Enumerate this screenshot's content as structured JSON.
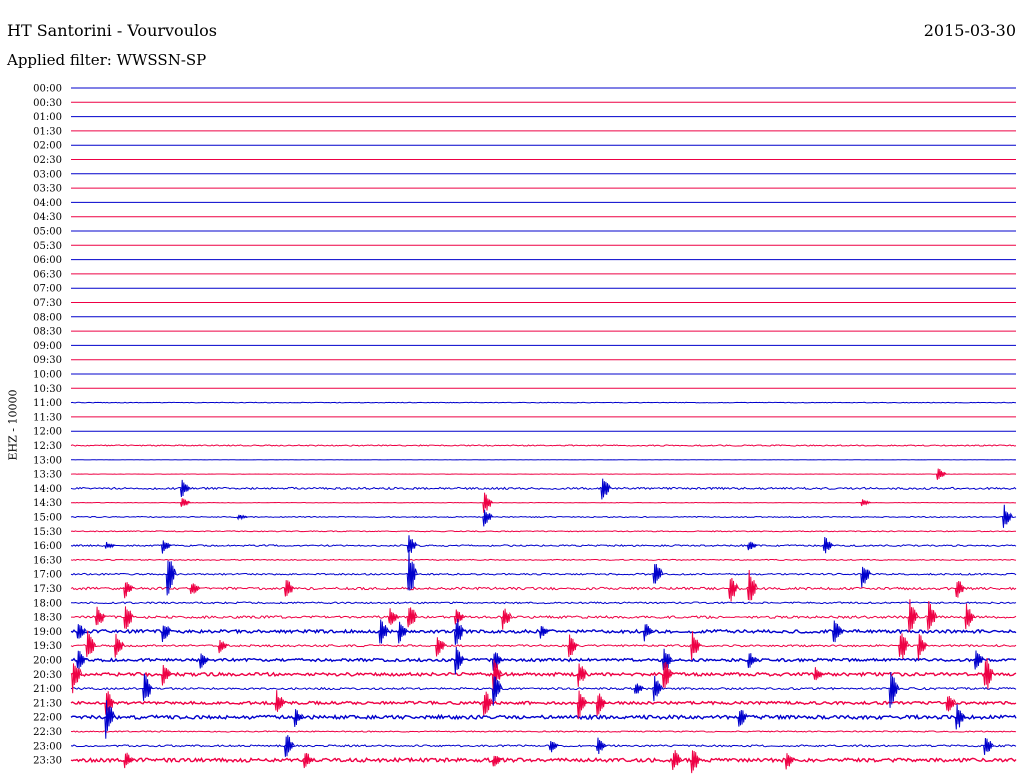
{
  "header": {
    "station": "HT Santorini - Vourvoulos",
    "date": "2015-03-30",
    "filter_label": "Applied filter: WWSSN-SP"
  },
  "chart_data": {
    "type": "line",
    "channel_label": "EHZ - 10000",
    "row_labels": [
      "00:00",
      "00:30",
      "01:00",
      "01:30",
      "02:00",
      "02:30",
      "03:00",
      "03:30",
      "04:00",
      "04:30",
      "05:00",
      "05:30",
      "06:00",
      "06:30",
      "07:00",
      "07:30",
      "08:00",
      "08:30",
      "09:00",
      "09:30",
      "10:00",
      "10:30",
      "11:00",
      "11:30",
      "12:00",
      "12:30",
      "13:00",
      "13:30",
      "14:00",
      "14:30",
      "15:00",
      "15:30",
      "16:00",
      "16:30",
      "17:00",
      "17:30",
      "18:00",
      "18:30",
      "19:00",
      "19:30",
      "20:00",
      "20:30",
      "21:00",
      "21:30",
      "22:00",
      "22:30",
      "23:00",
      "23:30"
    ],
    "trace_colors": [
      "#0000cc",
      "#ee0044"
    ],
    "noise_levels": [
      0,
      0,
      0,
      0,
      0,
      0,
      0,
      0,
      0,
      0,
      0,
      0,
      0,
      0,
      0,
      0,
      0,
      0,
      0,
      0,
      0,
      0,
      0.3,
      0,
      0,
      0.6,
      0.1,
      0.15,
      1.0,
      0.2,
      0.5,
      0.5,
      0.8,
      0.5,
      0.8,
      1.2,
      0.8,
      1.2,
      1.6,
      1.0,
      1.4,
      1.6,
      1.0,
      1.4,
      1.8,
      0.6,
      0.9,
      1.8
    ],
    "events": [
      {
        "row": 27,
        "x": 0.92,
        "amp": 8
      },
      {
        "row": 28,
        "x": 0.12,
        "amp": 10
      },
      {
        "row": 28,
        "x": 0.565,
        "amp": 14
      },
      {
        "row": 29,
        "x": 0.12,
        "amp": 6
      },
      {
        "row": 29,
        "x": 0.44,
        "amp": 12
      },
      {
        "row": 29,
        "x": 0.84,
        "amp": 4
      },
      {
        "row": 30,
        "x": 0.18,
        "amp": 3
      },
      {
        "row": 30,
        "x": 0.44,
        "amp": 10
      },
      {
        "row": 30,
        "x": 0.99,
        "amp": 14
      },
      {
        "row": 32,
        "x": 0.04,
        "amp": 4
      },
      {
        "row": 32,
        "x": 0.1,
        "amp": 8
      },
      {
        "row": 32,
        "x": 0.36,
        "amp": 12
      },
      {
        "row": 32,
        "x": 0.72,
        "amp": 6
      },
      {
        "row": 32,
        "x": 0.8,
        "amp": 10
      },
      {
        "row": 34,
        "x": 0.105,
        "amp": 25
      },
      {
        "row": 34,
        "x": 0.36,
        "amp": 30
      },
      {
        "row": 34,
        "x": 0.62,
        "amp": 18
      },
      {
        "row": 34,
        "x": 0.84,
        "amp": 14
      },
      {
        "row": 35,
        "x": 0.06,
        "amp": 10
      },
      {
        "row": 35,
        "x": 0.13,
        "amp": 8
      },
      {
        "row": 35,
        "x": 0.23,
        "amp": 12
      },
      {
        "row": 35,
        "x": 0.7,
        "amp": 16
      },
      {
        "row": 35,
        "x": 0.72,
        "amp": 22
      },
      {
        "row": 35,
        "x": 0.94,
        "amp": 12
      },
      {
        "row": 37,
        "x": 0.03,
        "amp": 14
      },
      {
        "row": 37,
        "x": 0.06,
        "amp": 16
      },
      {
        "row": 37,
        "x": 0.34,
        "amp": 12
      },
      {
        "row": 37,
        "x": 0.36,
        "amp": 18
      },
      {
        "row": 37,
        "x": 0.41,
        "amp": 10
      },
      {
        "row": 37,
        "x": 0.46,
        "amp": 14
      },
      {
        "row": 37,
        "x": 0.89,
        "amp": 20
      },
      {
        "row": 37,
        "x": 0.91,
        "amp": 18
      },
      {
        "row": 37,
        "x": 0.95,
        "amp": 16
      },
      {
        "row": 38,
        "x": 0.01,
        "amp": 10
      },
      {
        "row": 38,
        "x": 0.1,
        "amp": 12
      },
      {
        "row": 38,
        "x": 0.33,
        "amp": 16
      },
      {
        "row": 38,
        "x": 0.35,
        "amp": 12
      },
      {
        "row": 38,
        "x": 0.41,
        "amp": 18
      },
      {
        "row": 38,
        "x": 0.5,
        "amp": 8
      },
      {
        "row": 38,
        "x": 0.61,
        "amp": 10
      },
      {
        "row": 38,
        "x": 0.81,
        "amp": 14
      },
      {
        "row": 39,
        "x": 0.02,
        "amp": 18
      },
      {
        "row": 39,
        "x": 0.05,
        "amp": 14
      },
      {
        "row": 39,
        "x": 0.16,
        "amp": 8
      },
      {
        "row": 39,
        "x": 0.39,
        "amp": 12
      },
      {
        "row": 39,
        "x": 0.53,
        "amp": 14
      },
      {
        "row": 39,
        "x": 0.66,
        "amp": 16
      },
      {
        "row": 39,
        "x": 0.88,
        "amp": 20
      },
      {
        "row": 39,
        "x": 0.9,
        "amp": 16
      },
      {
        "row": 40,
        "x": 0.01,
        "amp": 12
      },
      {
        "row": 40,
        "x": 0.14,
        "amp": 10
      },
      {
        "row": 40,
        "x": 0.41,
        "amp": 16
      },
      {
        "row": 40,
        "x": 0.45,
        "amp": 12
      },
      {
        "row": 40,
        "x": 0.63,
        "amp": 18
      },
      {
        "row": 40,
        "x": 0.72,
        "amp": 10
      },
      {
        "row": 40,
        "x": 0.96,
        "amp": 12
      },
      {
        "row": 41,
        "x": 0.005,
        "amp": 22
      },
      {
        "row": 41,
        "x": 0.1,
        "amp": 12
      },
      {
        "row": 41,
        "x": 0.45,
        "amp": 18
      },
      {
        "row": 41,
        "x": 0.54,
        "amp": 14
      },
      {
        "row": 41,
        "x": 0.63,
        "amp": 20
      },
      {
        "row": 41,
        "x": 0.79,
        "amp": 10
      },
      {
        "row": 41,
        "x": 0.97,
        "amp": 22
      },
      {
        "row": 42,
        "x": 0.08,
        "amp": 18
      },
      {
        "row": 42,
        "x": 0.45,
        "amp": 20
      },
      {
        "row": 42,
        "x": 0.6,
        "amp": 8
      },
      {
        "row": 42,
        "x": 0.62,
        "amp": 14
      },
      {
        "row": 42,
        "x": 0.87,
        "amp": 20
      },
      {
        "row": 43,
        "x": 0.04,
        "amp": 16
      },
      {
        "row": 43,
        "x": 0.22,
        "amp": 14
      },
      {
        "row": 43,
        "x": 0.44,
        "amp": 16
      },
      {
        "row": 43,
        "x": 0.54,
        "amp": 18
      },
      {
        "row": 43,
        "x": 0.56,
        "amp": 14
      },
      {
        "row": 43,
        "x": 0.93,
        "amp": 12
      },
      {
        "row": 44,
        "x": 0.04,
        "amp": 24
      },
      {
        "row": 44,
        "x": 0.24,
        "amp": 10
      },
      {
        "row": 44,
        "x": 0.71,
        "amp": 12
      },
      {
        "row": 44,
        "x": 0.94,
        "amp": 16
      },
      {
        "row": 46,
        "x": 0.23,
        "amp": 16
      },
      {
        "row": 46,
        "x": 0.51,
        "amp": 8
      },
      {
        "row": 46,
        "x": 0.56,
        "amp": 10
      },
      {
        "row": 46,
        "x": 0.97,
        "amp": 12
      },
      {
        "row": 47,
        "x": 0.06,
        "amp": 10
      },
      {
        "row": 47,
        "x": 0.25,
        "amp": 12
      },
      {
        "row": 47,
        "x": 0.45,
        "amp": 8
      },
      {
        "row": 47,
        "x": 0.64,
        "amp": 14
      },
      {
        "row": 47,
        "x": 0.66,
        "amp": 16
      },
      {
        "row": 47,
        "x": 0.76,
        "amp": 10
      }
    ]
  }
}
